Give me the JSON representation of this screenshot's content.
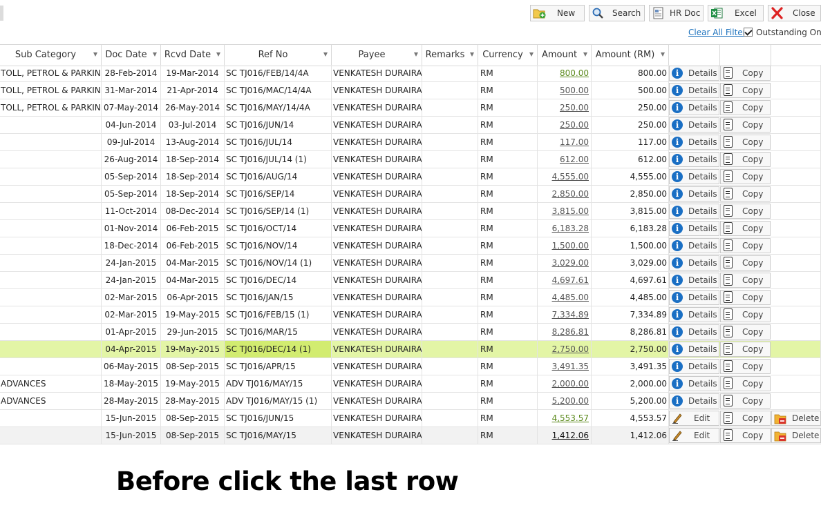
{
  "toolbar": {
    "new_label": "New",
    "search_label": "Search",
    "hrdoc_label": "HR Doc",
    "excel_label": "Excel",
    "close_label": "Close"
  },
  "filter": {
    "clear_all_label": "Clear All Filter",
    "outstanding_label": "Outstanding Only",
    "outstanding_checked": true
  },
  "columns": [
    "Sub Category",
    "Doc Date",
    "Rcvd Date",
    "Ref No",
    "Payee",
    "Remarks",
    "Currency",
    "Amount",
    "Amount (RM)"
  ],
  "action_labels": {
    "details": "Details",
    "copy": "Copy",
    "edit": "Edit",
    "delete": "Delete"
  },
  "colors": {
    "selected_row": "#e3f5a6",
    "selected_cell": "#d2ec70",
    "link_green": "#5b8a1c",
    "info_blue": "#1a6fc4"
  },
  "rows": [
    {
      "sub": "TOLL, PETROL & PARKING",
      "doc": "28-Feb-2014",
      "rcvd": "19-Mar-2014",
      "ref": "SC TJ016/FEB/14/4A",
      "payee": "VENKATESH DURAIRAJ",
      "remarks": "",
      "cur": "RM",
      "amt": "800.00",
      "amt_rm": "800.00",
      "amt_color": "green",
      "mode": "view"
    },
    {
      "sub": "TOLL, PETROL & PARKING",
      "doc": "31-Mar-2014",
      "rcvd": "21-Apr-2014",
      "ref": "SC TJ016/MAC/14/4A",
      "payee": "VENKATESH DURAIRAJ",
      "remarks": "",
      "cur": "RM",
      "amt": "500.00",
      "amt_rm": "500.00",
      "amt_color": "gray",
      "mode": "view"
    },
    {
      "sub": "TOLL, PETROL & PARKING",
      "doc": "07-May-2014",
      "rcvd": "26-May-2014",
      "ref": "SC TJ016/MAY/14/4A",
      "payee": "VENKATESH DURAIRAJ",
      "remarks": "",
      "cur": "RM",
      "amt": "250.00",
      "amt_rm": "250.00",
      "amt_color": "gray",
      "mode": "view"
    },
    {
      "sub": "",
      "doc": "04-Jun-2014",
      "rcvd": "03-Jul-2014",
      "ref": "SC TJ016/JUN/14",
      "payee": "VENKATESH DURAIRAJ",
      "remarks": "",
      "cur": "RM",
      "amt": "250.00",
      "amt_rm": "250.00",
      "amt_color": "gray",
      "mode": "view"
    },
    {
      "sub": "",
      "doc": "09-Jul-2014",
      "rcvd": "13-Aug-2014",
      "ref": "SC TJ016/JUL/14",
      "payee": "VENKATESH DURAIRAJ",
      "remarks": "",
      "cur": "RM",
      "amt": "117.00",
      "amt_rm": "117.00",
      "amt_color": "gray",
      "mode": "view"
    },
    {
      "sub": "",
      "doc": "26-Aug-2014",
      "rcvd": "18-Sep-2014",
      "ref": "SC TJ016/JUL/14 (1)",
      "payee": "VENKATESH DURAIRAJ",
      "remarks": "",
      "cur": "RM",
      "amt": "612.00",
      "amt_rm": "612.00",
      "amt_color": "gray",
      "mode": "view"
    },
    {
      "sub": "",
      "doc": "05-Sep-2014",
      "rcvd": "18-Sep-2014",
      "ref": "SC TJ016/AUG/14",
      "payee": "VENKATESH DURAIRAJ",
      "remarks": "",
      "cur": "RM",
      "amt": "4,555.00",
      "amt_rm": "4,555.00",
      "amt_color": "gray",
      "mode": "view"
    },
    {
      "sub": "",
      "doc": "05-Sep-2014",
      "rcvd": "18-Sep-2014",
      "ref": "SC TJ016/SEP/14",
      "payee": "VENKATESH DURAIRAJ",
      "remarks": "",
      "cur": "RM",
      "amt": "2,850.00",
      "amt_rm": "2,850.00",
      "amt_color": "gray",
      "mode": "view"
    },
    {
      "sub": "",
      "doc": "11-Oct-2014",
      "rcvd": "08-Dec-2014",
      "ref": "SC TJ016/SEP/14 (1)",
      "payee": "VENKATESH DURAIRAJ",
      "remarks": "",
      "cur": "RM",
      "amt": "3,815.00",
      "amt_rm": "3,815.00",
      "amt_color": "gray",
      "mode": "view"
    },
    {
      "sub": "",
      "doc": "01-Nov-2014",
      "rcvd": "06-Feb-2015",
      "ref": "SC TJ016/OCT/14",
      "payee": "VENKATESH DURAIRAJ",
      "remarks": "",
      "cur": "RM",
      "amt": "6,183.28",
      "amt_rm": "6,183.28",
      "amt_color": "gray",
      "mode": "view"
    },
    {
      "sub": "",
      "doc": "18-Dec-2014",
      "rcvd": "06-Feb-2015",
      "ref": "SC TJ016/NOV/14",
      "payee": "VENKATESH DURAIRAJ",
      "remarks": "",
      "cur": "RM",
      "amt": "1,500.00",
      "amt_rm": "1,500.00",
      "amt_color": "gray",
      "mode": "view"
    },
    {
      "sub": "",
      "doc": "24-Jan-2015",
      "rcvd": "04-Mar-2015",
      "ref": "SC TJ016/NOV/14 (1)",
      "payee": "VENKATESH DURAIRAJ",
      "remarks": "",
      "cur": "RM",
      "amt": "3,029.00",
      "amt_rm": "3,029.00",
      "amt_color": "gray",
      "mode": "view"
    },
    {
      "sub": "",
      "doc": "24-Jan-2015",
      "rcvd": "04-Mar-2015",
      "ref": "SC TJ016/DEC/14",
      "payee": "VENKATESH DURAIRAJ",
      "remarks": "",
      "cur": "RM",
      "amt": "4,697.61",
      "amt_rm": "4,697.61",
      "amt_color": "gray",
      "mode": "view"
    },
    {
      "sub": "",
      "doc": "02-Mar-2015",
      "rcvd": "06-Apr-2015",
      "ref": "SC TJ016/JAN/15",
      "payee": "VENKATESH DURAIRAJ",
      "remarks": "",
      "cur": "RM",
      "amt": "4,485.00",
      "amt_rm": "4,485.00",
      "amt_color": "gray",
      "mode": "view"
    },
    {
      "sub": "",
      "doc": "02-Mar-2015",
      "rcvd": "19-May-2015",
      "ref": "SC TJ016/FEB/15 (1)",
      "payee": "VENKATESH DURAIRAJ",
      "remarks": "",
      "cur": "RM",
      "amt": "7,334.89",
      "amt_rm": "7,334.89",
      "amt_color": "gray",
      "mode": "view"
    },
    {
      "sub": "",
      "doc": "01-Apr-2015",
      "rcvd": "29-Jun-2015",
      "ref": "SC TJ016/MAR/15",
      "payee": "VENKATESH DURAIRAJ",
      "remarks": "",
      "cur": "RM",
      "amt": "8,286.81",
      "amt_rm": "8,286.81",
      "amt_color": "gray",
      "mode": "view"
    },
    {
      "sub": "",
      "doc": "04-Apr-2015",
      "rcvd": "19-May-2015",
      "ref": "SC TJ016/DEC/14 (1)",
      "payee": "VENKATESH DURAIRAJ",
      "remarks": "",
      "cur": "RM",
      "amt": "2,750.00",
      "amt_rm": "2,750.00",
      "amt_color": "gray",
      "mode": "view",
      "selected": true
    },
    {
      "sub": "",
      "doc": "06-May-2015",
      "rcvd": "08-Sep-2015",
      "ref": "SC TJ016/APR/15",
      "payee": "VENKATESH DURAIRAJ",
      "remarks": "",
      "cur": "RM",
      "amt": "3,491.35",
      "amt_rm": "3,491.35",
      "amt_color": "gray",
      "mode": "view"
    },
    {
      "sub": "ADVANCES",
      "doc": "18-May-2015",
      "rcvd": "19-May-2015",
      "ref": "ADV TJ016/MAY/15",
      "payee": "VENKATESH DURAIRAJ",
      "remarks": "",
      "cur": "RM",
      "amt": "2,000.00",
      "amt_rm": "2,000.00",
      "amt_color": "gray",
      "mode": "view"
    },
    {
      "sub": "ADVANCES",
      "doc": "28-May-2015",
      "rcvd": "28-May-2015",
      "ref": "ADV TJ016/MAY/15 (1)",
      "payee": "VENKATESH DURAIRAJ",
      "remarks": "",
      "cur": "RM",
      "amt": "5,200.00",
      "amt_rm": "5,200.00",
      "amt_color": "gray",
      "mode": "view"
    },
    {
      "sub": "",
      "doc": "15-Jun-2015",
      "rcvd": "08-Sep-2015",
      "ref": "SC TJ016/JUN/15",
      "payee": "VENKATESH DURAIRAJ",
      "remarks": "",
      "cur": "RM",
      "amt": "4,553.57",
      "amt_rm": "4,553.57",
      "amt_color": "green",
      "mode": "edit"
    },
    {
      "sub": "",
      "doc": "15-Jun-2015",
      "rcvd": "08-Sep-2015",
      "ref": "SC TJ016/MAY/15",
      "payee": "VENKATESH DURAIRAJ",
      "remarks": "",
      "cur": "RM",
      "amt": "1,412.06",
      "amt_rm": "1,412.06",
      "amt_color": "dark",
      "mode": "edit",
      "last": true
    }
  ],
  "caption": "Before click the last row"
}
